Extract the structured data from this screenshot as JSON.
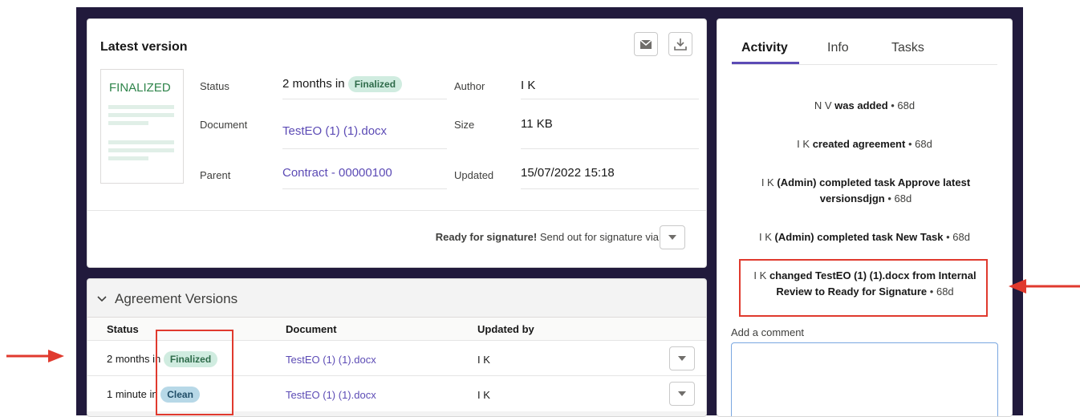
{
  "latest_version": {
    "title": "Latest version",
    "thumbnail_label": "FINALIZED",
    "fields": {
      "status_label": "Status",
      "status_value": "2 months in",
      "status_badge": "Finalized",
      "author_label": "Author",
      "author_value": "I K",
      "document_label": "Document",
      "document_value": "TestEO (1) (1).docx",
      "size_label": "Size",
      "size_value": "11 KB",
      "parent_label": "Parent",
      "parent_value": "Contract - 00000100",
      "updated_label": "Updated",
      "updated_value": "15/07/2022 15:18"
    },
    "ready_bold": "Ready for signature!",
    "ready_text": "Send out for signature via"
  },
  "versions": {
    "title": "Agreement Versions",
    "columns": [
      "Status",
      "Document",
      "Updated by"
    ],
    "rows": [
      {
        "status": "2 months in",
        "badge": "Finalized",
        "document": "TestEO (1) (1).docx",
        "updated_by": "I K"
      },
      {
        "status": "1 minute in",
        "badge": "Clean",
        "document": "TestEO (1) (1).docx",
        "updated_by": "I K"
      }
    ]
  },
  "activity": {
    "tabs": [
      "Activity",
      "Info",
      "Tasks"
    ],
    "items": [
      {
        "who": "N V",
        "what": "was added",
        "when": "• 68d"
      },
      {
        "who": "I K",
        "what": "created agreement",
        "when": "• 68d"
      },
      {
        "who": "I K",
        "what": "(Admin) completed task Approve latest versionsdjgn",
        "when": "• 68d"
      },
      {
        "who": "I K",
        "what": "(Admin) completed task New Task",
        "when": "• 68d"
      },
      {
        "who": "I K",
        "what": "changed TestEO (1) (1).docx from Internal Review to Ready for Signature",
        "when": "• 68d"
      }
    ],
    "comment_label": "Add a comment",
    "comment_value": ""
  },
  "colors": {
    "accent": "#5c4bb5",
    "frame": "#211a3c",
    "annotation": "#e03a2e"
  }
}
